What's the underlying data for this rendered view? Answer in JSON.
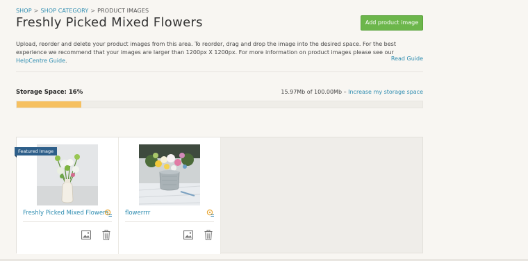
{
  "breadcrumb": {
    "items": [
      {
        "label": "SHOP",
        "link": true
      },
      {
        "label": "SHOP CATEGORY",
        "link": true
      },
      {
        "label": "PRODUCT IMAGES",
        "link": false
      }
    ],
    "separator": ">"
  },
  "page": {
    "title": "Freshly Picked Mixed Flowers",
    "add_button_label": "Add product image",
    "description_text": "Upload, reorder and delete your product images from this area. To reorder, drag and drop the image into the desired space. For the best experience we recommend that your images are larger than 1200px X 1200px. For more information on product images please see our ",
    "description_link": "HelpCentre Guide",
    "description_end": ".",
    "read_guide_label": "Read Guide"
  },
  "storage": {
    "label": "Storage Space: 16%",
    "percent": 16,
    "usage_text": "15.97Mb of 100.00Mb – ",
    "increase_link": "Increase my storage space"
  },
  "images": [
    {
      "name": "Freshly Picked Mixed Flowers",
      "featured": true,
      "featured_label": "Featured Image"
    },
    {
      "name": "flowerrrr",
      "featured": false
    }
  ],
  "colors": {
    "accent": "#2d8cb0",
    "button": "#6cb64b",
    "bar_fill": "#f6c060",
    "featured_badge": "#2e5f8a"
  },
  "icons": [
    "image-icon",
    "trash-icon",
    "settings-badge-icon"
  ]
}
